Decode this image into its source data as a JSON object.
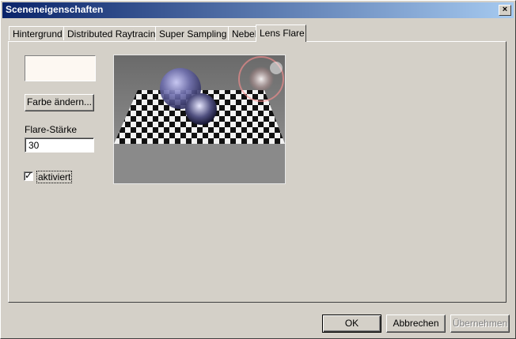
{
  "window": {
    "title": "Sceneneigenschaften",
    "close_symbol": "×"
  },
  "tabs": [
    {
      "label": "Hintergrund"
    },
    {
      "label": "Distributed Raytracing"
    },
    {
      "label": "Super Sampling"
    },
    {
      "label": "Nebel"
    },
    {
      "label": "Lens Flare",
      "active": true
    }
  ],
  "lens_flare": {
    "color_swatch": "#fdf8f2",
    "change_color_label": "Farbe ändern...",
    "strength_label": "Flare-Stärke",
    "strength_value": "30",
    "enabled_label": "aktiviert",
    "enabled": true,
    "check_symbol": "✓"
  },
  "footer": {
    "ok_label": "OK",
    "cancel_label": "Abbrechen",
    "apply_label": "Übernehmen"
  },
  "colors": {
    "face": "#d4d0c8",
    "titlebar_start": "#0a246a",
    "titlebar_end": "#a6caf0"
  }
}
